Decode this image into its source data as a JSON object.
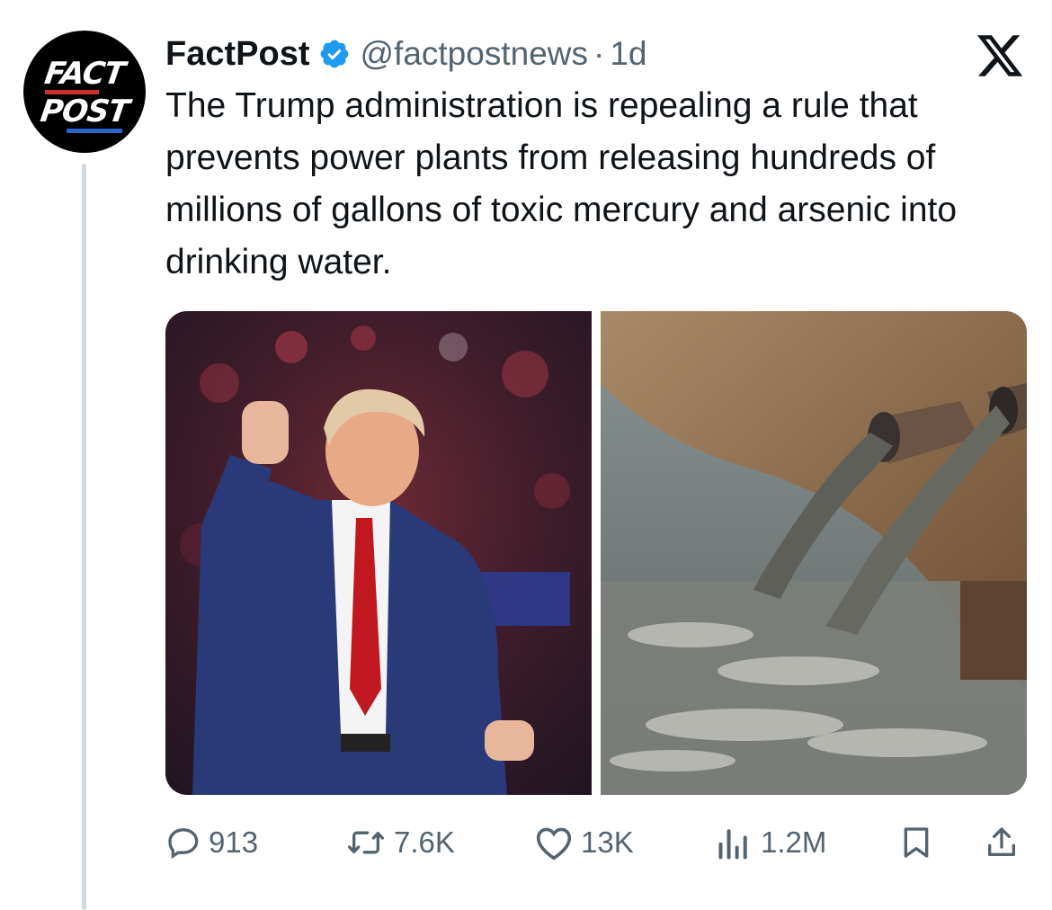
{
  "tweet": {
    "author_name": "FactPost",
    "handle": "@factpostnews",
    "separator": "·",
    "time": "1d",
    "text": "The Trump administration is repealing a rule that prevents power plants from releasing hundreds of millions of gallons of toxic mercury and arsenic into drinking water."
  },
  "avatar": {
    "line1": "FACT",
    "line2": "POST",
    "accent_red": "#c9302c",
    "accent_blue": "#2a63c9"
  },
  "media": {
    "left_image": "photo-speaker-raised-fist",
    "right_image": "photo-pipes-discharging-water"
  },
  "actions": {
    "replies": "913",
    "reposts": "7.6K",
    "likes": "13K",
    "views": "1.2M"
  },
  "colors": {
    "verified": "#1d9bf0",
    "text": "#0f1419",
    "muted": "#536471",
    "thread_line": "#cfd9de"
  }
}
